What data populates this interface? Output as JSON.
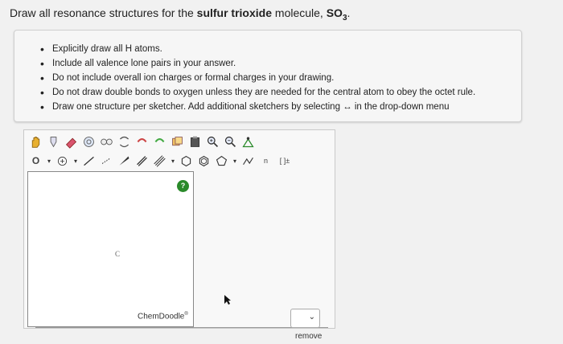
{
  "question": {
    "prefix": "Draw all resonance structures for the ",
    "bold": "sulfur trioxide",
    "suffix": " molecule, ",
    "formula_main": "SO",
    "formula_sub": "3",
    "end": "."
  },
  "instructions": [
    "Explicitly draw all H atoms.",
    "Include all valence lone pairs in your answer.",
    "Do not include overall ion charges or formal charges in your drawing.",
    "Do not draw double bonds to oxygen unless they are needed for the central atom to obey the octet rule.",
    "Draw one structure per sketcher. Add additional sketchers by selecting ↔ in the drop-down menu"
  ],
  "sketcher": {
    "atom_label": "O",
    "canvas_letter": "C",
    "help": "?",
    "brand": "ChemDoodle",
    "brand_mark": "®",
    "template_n": "n",
    "charge_label": "[ ]±"
  },
  "controls": {
    "remove_label": "remove",
    "select_chevron": "⌄"
  },
  "colors": {
    "help_green": "#2a8a2a",
    "accent": "#2a8a2a"
  }
}
